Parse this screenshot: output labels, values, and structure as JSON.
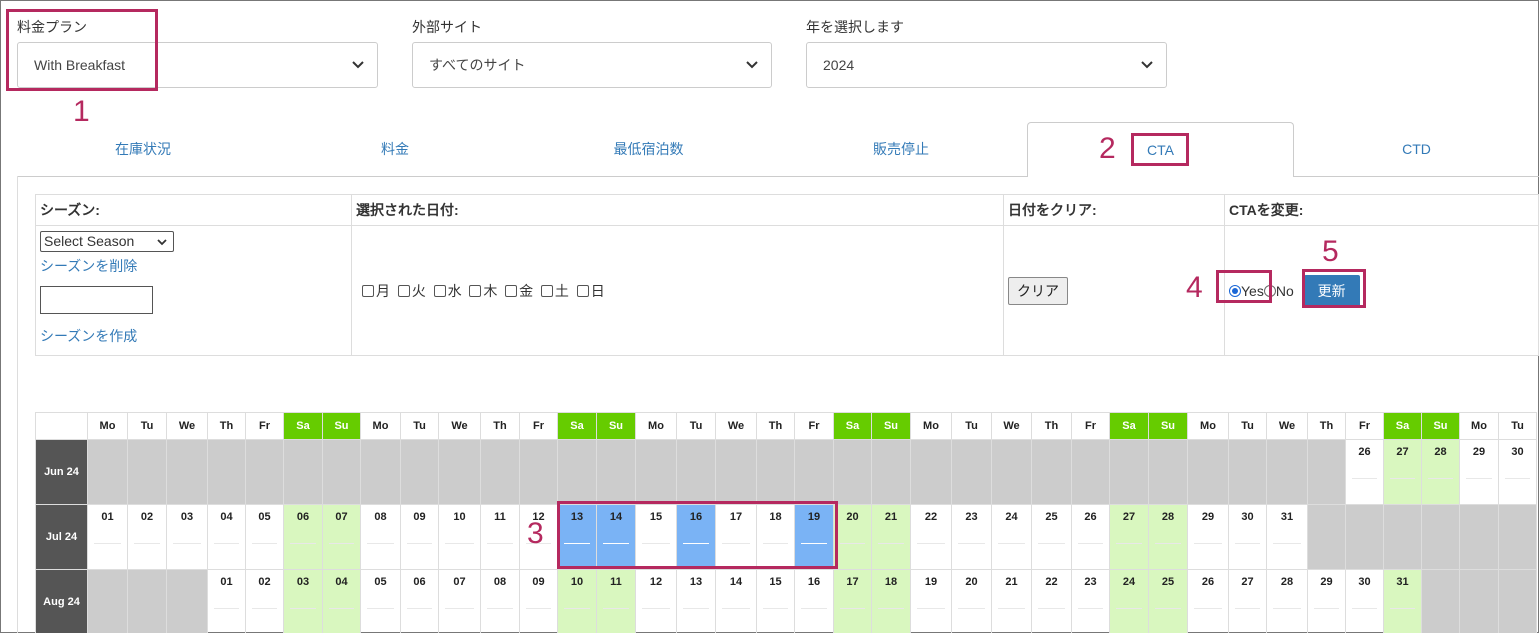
{
  "filters": {
    "rate_plan": {
      "label": "料金プラン",
      "value": "With Breakfast"
    },
    "external_site": {
      "label": "外部サイト",
      "value": "すべてのサイト"
    },
    "year": {
      "label": "年を選択します",
      "value": "2024"
    }
  },
  "tabs": [
    {
      "label": "在庫状況"
    },
    {
      "label": "料金"
    },
    {
      "label": "最低宿泊数"
    },
    {
      "label": "販売停止"
    },
    {
      "label": "CTA"
    },
    {
      "label": "CTD"
    }
  ],
  "annotations": [
    "1",
    "2",
    "3",
    "4",
    "5"
  ],
  "controls": {
    "season_header": "シーズン:",
    "season_select": "Select Season",
    "delete_season": "シーズンを削除",
    "create_season": "シーズンを作成",
    "selected_dates_header": "選択された日付:",
    "weekdays": [
      "月",
      "火",
      "水",
      "木",
      "金",
      "土",
      "日"
    ],
    "clear_header": "日付をクリア:",
    "clear_button": "クリア",
    "change_header": "CTAを変更:",
    "yes_label": "Yes",
    "no_label": "No",
    "update_button": "更新"
  },
  "calendar": {
    "day_headers": [
      "Mo",
      "Tu",
      "We",
      "Th",
      "Fr",
      "Sa",
      "Su",
      "Mo",
      "Tu",
      "We",
      "Th",
      "Fr",
      "Sa",
      "Su",
      "Mo",
      "Tu",
      "We",
      "Th",
      "Fr",
      "Sa",
      "Su",
      "Mo",
      "Tu",
      "We",
      "Th",
      "Fr",
      "Sa",
      "Su",
      "Mo",
      "Tu",
      "We",
      "Th",
      "Fr",
      "Sa",
      "Su",
      "Mo",
      "Tu"
    ],
    "months": [
      {
        "label": "Jun 24",
        "offset": 32,
        "days": [
          "26",
          "27",
          "28",
          "29",
          "30"
        ]
      },
      {
        "label": "Jul 24",
        "offset": 0,
        "days": [
          "01",
          "02",
          "03",
          "04",
          "05",
          "06",
          "07",
          "08",
          "09",
          "10",
          "11",
          "12",
          "13",
          "14",
          "15",
          "16",
          "17",
          "18",
          "19",
          "20",
          "21",
          "22",
          "23",
          "24",
          "25",
          "26",
          "27",
          "28",
          "29",
          "30",
          "31"
        ]
      },
      {
        "label": "Aug 24",
        "offset": 3,
        "days": [
          "01",
          "02",
          "03",
          "04",
          "05",
          "06",
          "07",
          "08",
          "09",
          "10",
          "11",
          "12",
          "13",
          "14",
          "15",
          "16",
          "17",
          "18",
          "19",
          "20",
          "21",
          "22",
          "23",
          "24",
          "25",
          "26",
          "27",
          "28",
          "29",
          "30",
          "31"
        ]
      }
    ],
    "selected": {
      "Jul 24": [
        "13",
        "14",
        "16",
        "19"
      ]
    }
  },
  "colors": {
    "accent": "#b5295f",
    "link": "#337ab7",
    "weekend_header": "#66cc00",
    "weekend_cell": "#d9f7bf",
    "selected_cell": "#7ab3f5",
    "disabled_cell": "#cccccc"
  }
}
